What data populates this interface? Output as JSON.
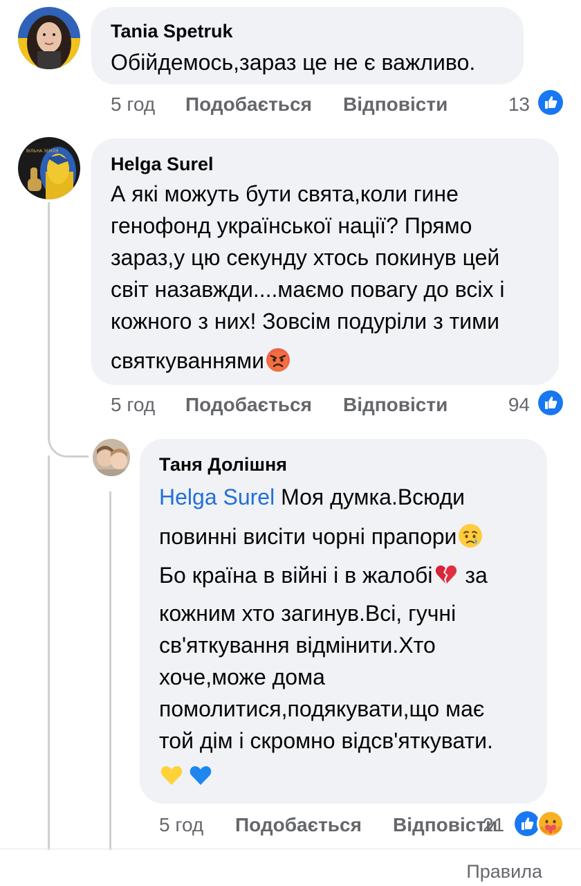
{
  "comments": [
    {
      "author": "Tania Spetruk",
      "text_lines": [
        "Обійдемось,зараз це не є важливо."
      ],
      "time": "5 год",
      "like_label": "Подобається",
      "reply_label": "Відповісти",
      "reaction_count": "13",
      "reactions": [
        "like-icon"
      ]
    },
    {
      "author": "Helga Surel",
      "text_lines": [
        "А які можуть бути свята,коли гине",
        "генофонд української нації? Прямо",
        "зараз,у цю секунду хтось покинув цей",
        "світ назавжди....маємо повагу до всіх і",
        "кожного з них! Зовсім подуріли з тими",
        "святкуваннями"
      ],
      "trailing_emoji": "angry-face-emoji",
      "time": "5 год",
      "like_label": "Подобається",
      "reply_label": "Відповісти",
      "reaction_count": "94",
      "reactions": [
        "like-icon"
      ]
    }
  ],
  "reply": {
    "author": "Таня Долішня",
    "mention": "Helga Surel",
    "text_lines": [
      "Моя думка.Всюди",
      "повинні висіти чорні прапори",
      "Бо країна в війні і в жалобі",
      "за",
      "кожним хто загинув.Всі, гучні",
      "св'яткування відмінити.Хто",
      "хоче,може дома",
      "помолитися,подякувати,що має",
      "той дім і скромно відсв'яткувати."
    ],
    "emojis": [
      "crying-face-emoji",
      "broken-heart-emoji",
      "yellow-heart-emoji",
      "blue-heart-emoji"
    ],
    "time": "5 год",
    "like_label": "Подобається",
    "reply_label": "Відповісти",
    "reaction_count": "21",
    "reactions": [
      "like-icon",
      "care-icon"
    ]
  },
  "footer": {
    "rules_label": "Правила"
  },
  "colors": {
    "bubble": "#f0f2f5",
    "meta_text": "#65676b",
    "mention": "#216fdb",
    "like_blue": "#1877f2",
    "thread_line": "#ced0d4"
  }
}
